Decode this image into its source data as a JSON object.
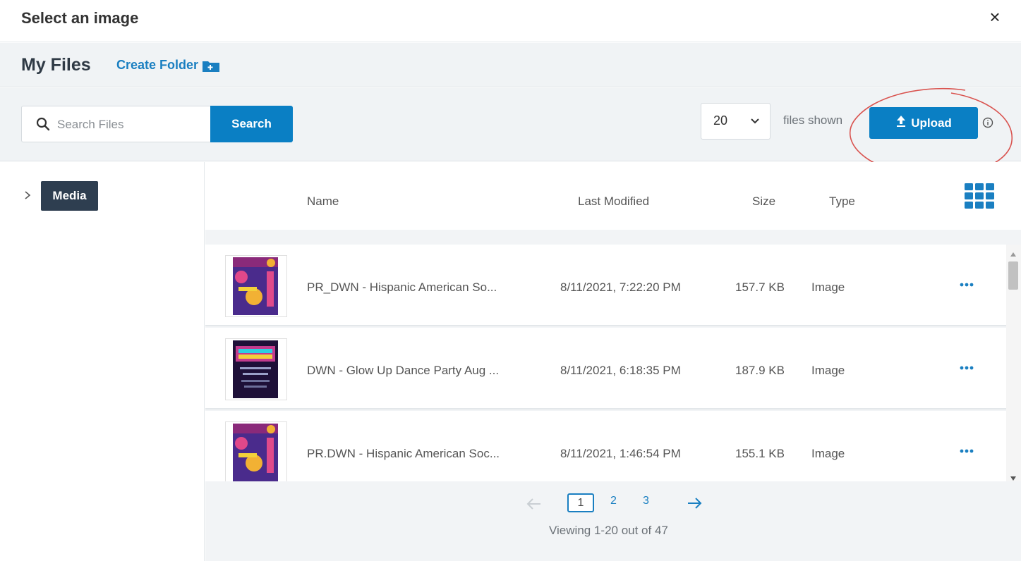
{
  "dialog": {
    "title": "Select an image",
    "close_label": "×"
  },
  "files_bar": {
    "heading": "My Files",
    "create_folder_label": "Create Folder"
  },
  "toolbar": {
    "search_placeholder": "Search Files",
    "search_button_label": "Search",
    "page_size_value": "20",
    "files_shown_label": "files shown",
    "upload_button_label": "Upload"
  },
  "sidebar": {
    "folder_label": "Media"
  },
  "table": {
    "columns": {
      "name": "Name",
      "last_modified": "Last Modified",
      "size": "Size",
      "type": "Type"
    },
    "rows": [
      {
        "name": "PR_DWN - Hispanic American So...",
        "last_modified": "8/11/2021, 7:22:20 PM",
        "size": "157.7 KB",
        "type": "Image"
      },
      {
        "name": "DWN - Glow Up Dance Party Aug ...",
        "last_modified": "8/11/2021, 6:18:35 PM",
        "size": "187.9 KB",
        "type": "Image"
      },
      {
        "name": "PR.DWN - Hispanic American Soc...",
        "last_modified": "8/11/2021, 1:46:54 PM",
        "size": "155.1 KB",
        "type": "Image"
      }
    ]
  },
  "pagination": {
    "pages": [
      "1",
      "2",
      "3"
    ],
    "current_page": "1",
    "viewing_text": "Viewing 1-20 out of 47"
  },
  "colors": {
    "accent": "#0a7fc4",
    "badge": "#2e3e50",
    "annotation": "#d9534f"
  }
}
